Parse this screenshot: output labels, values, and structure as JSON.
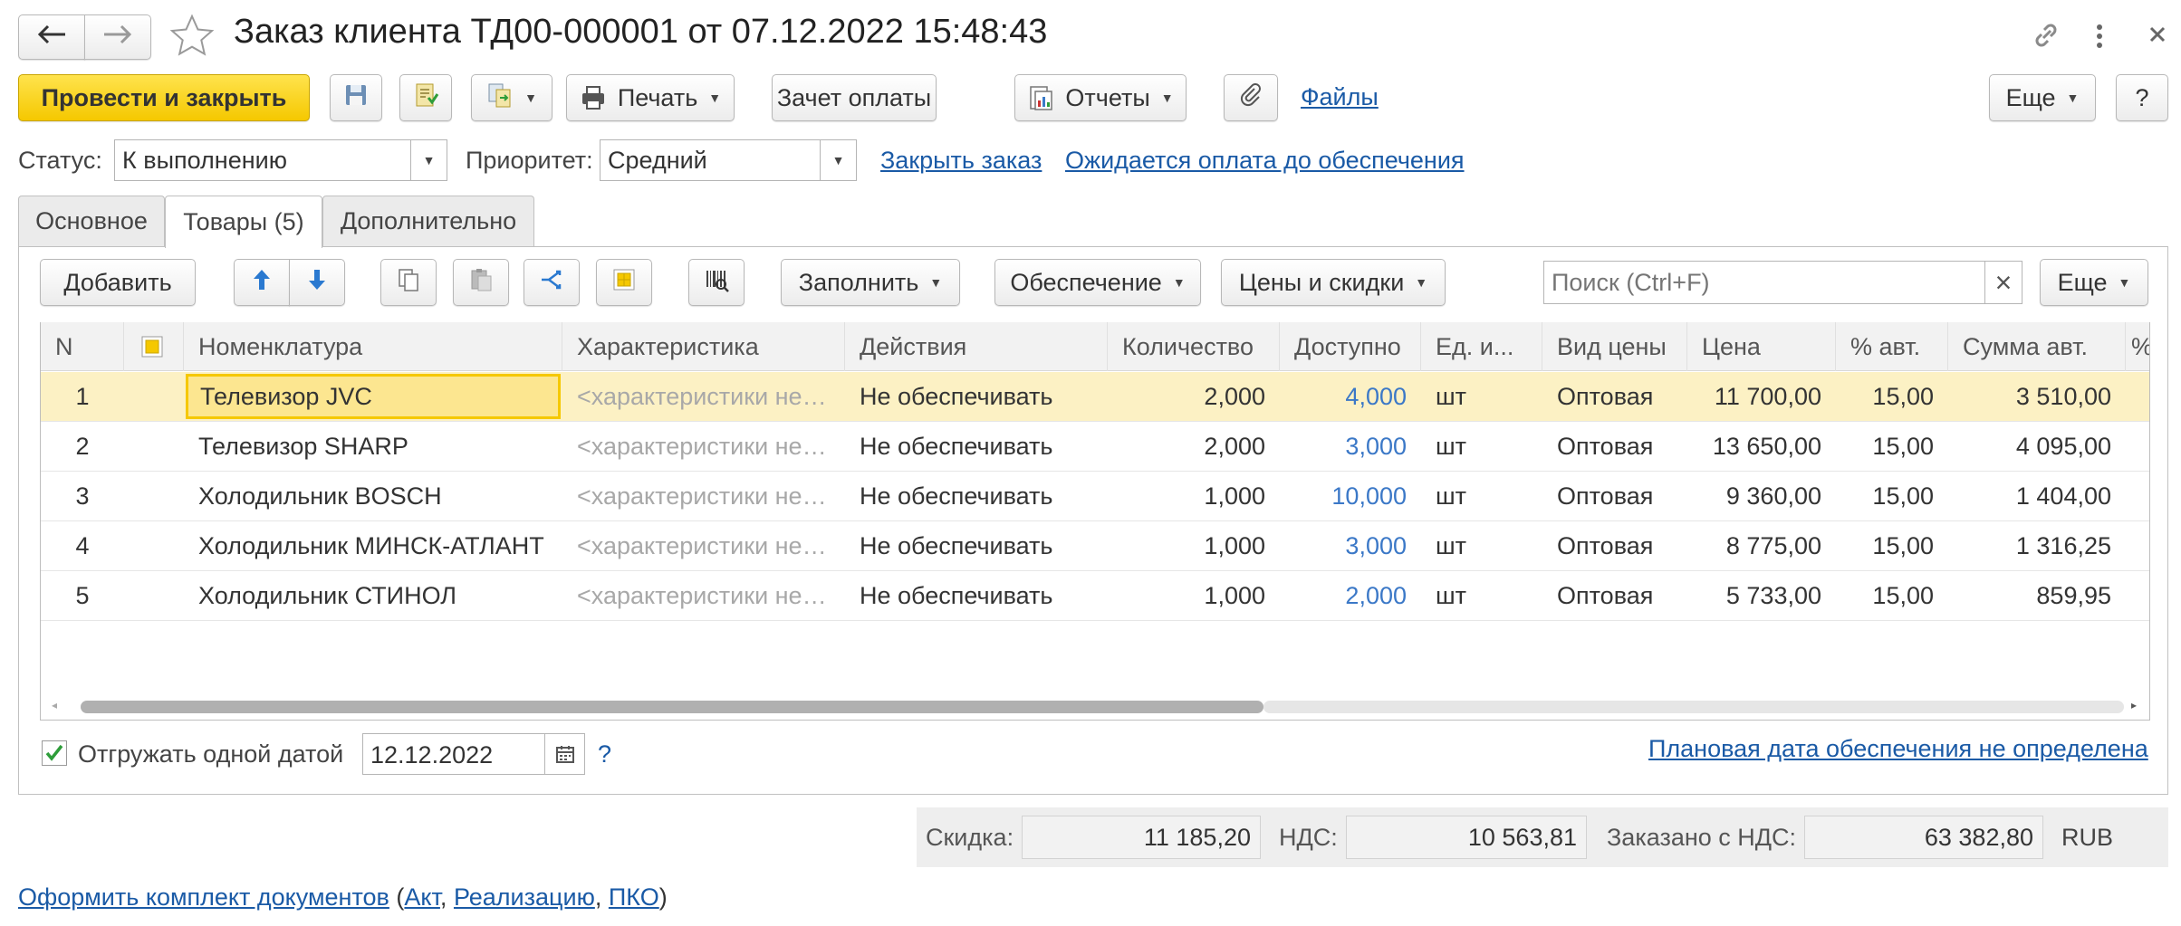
{
  "window": {
    "title": "Заказ клиента ТД00-000001 от 07.12.2022 15:48:43"
  },
  "toolbar": {
    "post_close": "Провести и закрыть",
    "print": "Печать",
    "payment_offset": "Зачет оплаты",
    "reports": "Отчеты",
    "files": "Файлы",
    "more": "Еще",
    "help": "?"
  },
  "status_bar": {
    "status_label": "Статус:",
    "status_value": "К выполнению",
    "priority_label": "Приоритет:",
    "priority_value": "Средний",
    "close_order_link": "Закрыть заказ",
    "awaiting_payment_link": "Ожидается оплата до обеспечения"
  },
  "tabs": [
    {
      "label": "Основное"
    },
    {
      "label": "Товары (5)"
    },
    {
      "label": "Дополнительно"
    }
  ],
  "goods_toolbar": {
    "add": "Добавить",
    "fill": "Заполнить",
    "provision": "Обеспечение",
    "prices_discounts": "Цены и скидки",
    "search_placeholder": "Поиск (Ctrl+F)",
    "clear": "×",
    "more": "Еще"
  },
  "table": {
    "columns": [
      "N",
      "",
      "Номенклатура",
      "Характеристика",
      "Действия",
      "Количество",
      "Доступно",
      "Ед. и...",
      "Вид цены",
      "Цена",
      "% авт.",
      "Сумма авт.",
      "%"
    ],
    "rows": [
      {
        "n": "1",
        "item": "Телевизор JVC",
        "characteristic": "<характеристики не используются>",
        "action": "Не обеспечивать",
        "qty": "2,000",
        "available": "4,000",
        "unit": "шт",
        "price_type": "Оптовая",
        "price": "11 700,00",
        "auto_pct": "15,00",
        "auto_sum": "3 510,00"
      },
      {
        "n": "2",
        "item": "Телевизор SHARP",
        "characteristic": "<характеристики не используются>",
        "action": "Не обеспечивать",
        "qty": "2,000",
        "available": "3,000",
        "unit": "шт",
        "price_type": "Оптовая",
        "price": "13 650,00",
        "auto_pct": "15,00",
        "auto_sum": "4 095,00"
      },
      {
        "n": "3",
        "item": "Холодильник BOSCH",
        "characteristic": "<характеристики не используются>",
        "action": "Не обеспечивать",
        "qty": "1,000",
        "available": "10,000",
        "unit": "шт",
        "price_type": "Оптовая",
        "price": "9 360,00",
        "auto_pct": "15,00",
        "auto_sum": "1 404,00"
      },
      {
        "n": "4",
        "item": "Холодильник МИНСК-АТЛАНТ",
        "characteristic": "<характеристики не используются>",
        "action": "Не обеспечивать",
        "qty": "1,000",
        "available": "3,000",
        "unit": "шт",
        "price_type": "Оптовая",
        "price": "8 775,00",
        "auto_pct": "15,00",
        "auto_sum": "1 316,25"
      },
      {
        "n": "5",
        "item": "Холодильник СТИНОЛ",
        "characteristic": "<характеристики не используются>",
        "action": "Не обеспечивать",
        "qty": "1,000",
        "available": "2,000",
        "unit": "шт",
        "price_type": "Оптовая",
        "price": "5 733,00",
        "auto_pct": "15,00",
        "auto_sum": "859,95"
      }
    ]
  },
  "shipping": {
    "one_date_label": "Отгружать одной датой",
    "one_date_checked": true,
    "date_value": "12.12.2022",
    "help": "?",
    "plan_date_link": "Плановая дата обеспечения не определена"
  },
  "totals": {
    "discount_label": "Скидка:",
    "discount_value": "11 185,20",
    "vat_label": "НДС:",
    "vat_value": "10 563,81",
    "ordered_label": "Заказано с НДС:",
    "ordered_value": "63 382,80",
    "currency": "RUB"
  },
  "footer": {
    "make_set_link": "Оформить комплект документов",
    "open_paren": "(",
    "act_link": "Акт",
    "comma1": ",",
    "realization_link": "Реализацию",
    "comma2": ",",
    "pko_link": "ПКО",
    "close_paren": ")"
  },
  "colors": {
    "accent_yellow": "#f5c800",
    "link_blue": "#1a5aa6",
    "selected_row": "#fcf1c4",
    "available_blue": "#3b78c7",
    "check_green": "#2e9d3a"
  }
}
